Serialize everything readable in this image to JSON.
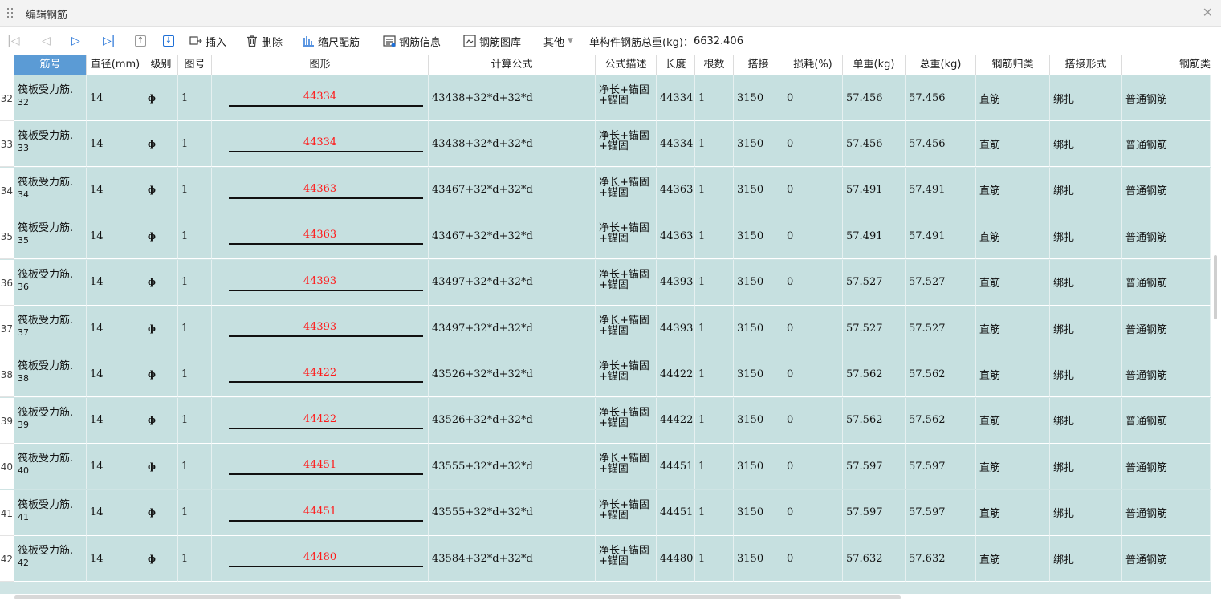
{
  "window": {
    "title": "编辑钢筋"
  },
  "toolbar": {
    "insert": "插入",
    "delete": "删除",
    "scale_rebar": "缩尺配筋",
    "rebar_info": "钢筋信息",
    "rebar_library": "钢筋图库",
    "other": "其他",
    "total_weight_label": "单构件钢筋总重(kg)：",
    "total_weight_value": "6632.406"
  },
  "columns": {
    "name": "筋号",
    "diameter": "直径(mm)",
    "grade": "级别",
    "figure_no": "图号",
    "shape": "图形",
    "formula": "计算公式",
    "formula_desc": "公式描述",
    "length": "长度",
    "count": "根数",
    "lap": "搭接",
    "loss": "损耗(%)",
    "unit_weight": "单重(kg)",
    "total_weight": "总重(kg)",
    "category": "钢筋归类",
    "lap_type": "搭接形式",
    "rebar_type": "钢筋类"
  },
  "rows": [
    {
      "row_no": "32",
      "name": "筏板受力筋.",
      "name_sub": "32",
      "diameter": "14",
      "grade": "ф",
      "figure_no": "1",
      "shape_value": "44334",
      "formula": "43438+32*d+32*d",
      "desc_1": "净长+锚固",
      "desc_2": "+锚固",
      "length": "44334",
      "count": "1",
      "lap": "3150",
      "loss": "0",
      "unit_weight": "57.456",
      "total_weight": "57.456",
      "category": "直筋",
      "lap_type": "绑扎",
      "rebar_type": "普通钢筋"
    },
    {
      "row_no": "33",
      "name": "筏板受力筋.",
      "name_sub": "33",
      "diameter": "14",
      "grade": "ф",
      "figure_no": "1",
      "shape_value": "44334",
      "formula": "43438+32*d+32*d",
      "desc_1": "净长+锚固",
      "desc_2": "+锚固",
      "length": "44334",
      "count": "1",
      "lap": "3150",
      "loss": "0",
      "unit_weight": "57.456",
      "total_weight": "57.456",
      "category": "直筋",
      "lap_type": "绑扎",
      "rebar_type": "普通钢筋"
    },
    {
      "row_no": "34",
      "name": "筏板受力筋.",
      "name_sub": "34",
      "diameter": "14",
      "grade": "ф",
      "figure_no": "1",
      "shape_value": "44363",
      "formula": "43467+32*d+32*d",
      "desc_1": "净长+锚固",
      "desc_2": "+锚固",
      "length": "44363",
      "count": "1",
      "lap": "3150",
      "loss": "0",
      "unit_weight": "57.491",
      "total_weight": "57.491",
      "category": "直筋",
      "lap_type": "绑扎",
      "rebar_type": "普通钢筋"
    },
    {
      "row_no": "35",
      "name": "筏板受力筋.",
      "name_sub": "35",
      "diameter": "14",
      "grade": "ф",
      "figure_no": "1",
      "shape_value": "44363",
      "formula": "43467+32*d+32*d",
      "desc_1": "净长+锚固",
      "desc_2": "+锚固",
      "length": "44363",
      "count": "1",
      "lap": "3150",
      "loss": "0",
      "unit_weight": "57.491",
      "total_weight": "57.491",
      "category": "直筋",
      "lap_type": "绑扎",
      "rebar_type": "普通钢筋"
    },
    {
      "row_no": "36",
      "name": "筏板受力筋.",
      "name_sub": "36",
      "diameter": "14",
      "grade": "ф",
      "figure_no": "1",
      "shape_value": "44393",
      "formula": "43497+32*d+32*d",
      "desc_1": "净长+锚固",
      "desc_2": "+锚固",
      "length": "44393",
      "count": "1",
      "lap": "3150",
      "loss": "0",
      "unit_weight": "57.527",
      "total_weight": "57.527",
      "category": "直筋",
      "lap_type": "绑扎",
      "rebar_type": "普通钢筋"
    },
    {
      "row_no": "37",
      "name": "筏板受力筋.",
      "name_sub": "37",
      "diameter": "14",
      "grade": "ф",
      "figure_no": "1",
      "shape_value": "44393",
      "formula": "43497+32*d+32*d",
      "desc_1": "净长+锚固",
      "desc_2": "+锚固",
      "length": "44393",
      "count": "1",
      "lap": "3150",
      "loss": "0",
      "unit_weight": "57.527",
      "total_weight": "57.527",
      "category": "直筋",
      "lap_type": "绑扎",
      "rebar_type": "普通钢筋"
    },
    {
      "row_no": "38",
      "name": "筏板受力筋.",
      "name_sub": "38",
      "diameter": "14",
      "grade": "ф",
      "figure_no": "1",
      "shape_value": "44422",
      "formula": "43526+32*d+32*d",
      "desc_1": "净长+锚固",
      "desc_2": "+锚固",
      "length": "44422",
      "count": "1",
      "lap": "3150",
      "loss": "0",
      "unit_weight": "57.562",
      "total_weight": "57.562",
      "category": "直筋",
      "lap_type": "绑扎",
      "rebar_type": "普通钢筋"
    },
    {
      "row_no": "39",
      "name": "筏板受力筋.",
      "name_sub": "39",
      "diameter": "14",
      "grade": "ф",
      "figure_no": "1",
      "shape_value": "44422",
      "formula": "43526+32*d+32*d",
      "desc_1": "净长+锚固",
      "desc_2": "+锚固",
      "length": "44422",
      "count": "1",
      "lap": "3150",
      "loss": "0",
      "unit_weight": "57.562",
      "total_weight": "57.562",
      "category": "直筋",
      "lap_type": "绑扎",
      "rebar_type": "普通钢筋"
    },
    {
      "row_no": "40",
      "name": "筏板受力筋.",
      "name_sub": "40",
      "diameter": "14",
      "grade": "ф",
      "figure_no": "1",
      "shape_value": "44451",
      "formula": "43555+32*d+32*d",
      "desc_1": "净长+锚固",
      "desc_2": "+锚固",
      "length": "44451",
      "count": "1",
      "lap": "3150",
      "loss": "0",
      "unit_weight": "57.597",
      "total_weight": "57.597",
      "category": "直筋",
      "lap_type": "绑扎",
      "rebar_type": "普通钢筋"
    },
    {
      "row_no": "41",
      "name": "筏板受力筋.",
      "name_sub": "41",
      "diameter": "14",
      "grade": "ф",
      "figure_no": "1",
      "shape_value": "44451",
      "formula": "43555+32*d+32*d",
      "desc_1": "净长+锚固",
      "desc_2": "+锚固",
      "length": "44451",
      "count": "1",
      "lap": "3150",
      "loss": "0",
      "unit_weight": "57.597",
      "total_weight": "57.597",
      "category": "直筋",
      "lap_type": "绑扎",
      "rebar_type": "普通钢筋"
    },
    {
      "row_no": "42",
      "name": "筏板受力筋.",
      "name_sub": "42",
      "diameter": "14",
      "grade": "ф",
      "figure_no": "1",
      "shape_value": "44480",
      "formula": "43584+32*d+32*d",
      "desc_1": "净长+锚固",
      "desc_2": "+锚固",
      "length": "44480",
      "count": "1",
      "lap": "3150",
      "loss": "0",
      "unit_weight": "57.632",
      "total_weight": "57.632",
      "category": "直筋",
      "lap_type": "绑扎",
      "rebar_type": "普通钢筋"
    }
  ],
  "colors": {
    "row_bg": "#c6e0e0",
    "header_selected": "#5b9bd5",
    "shape_value": "#ff1a1a",
    "accent": "#1e6fd6"
  }
}
